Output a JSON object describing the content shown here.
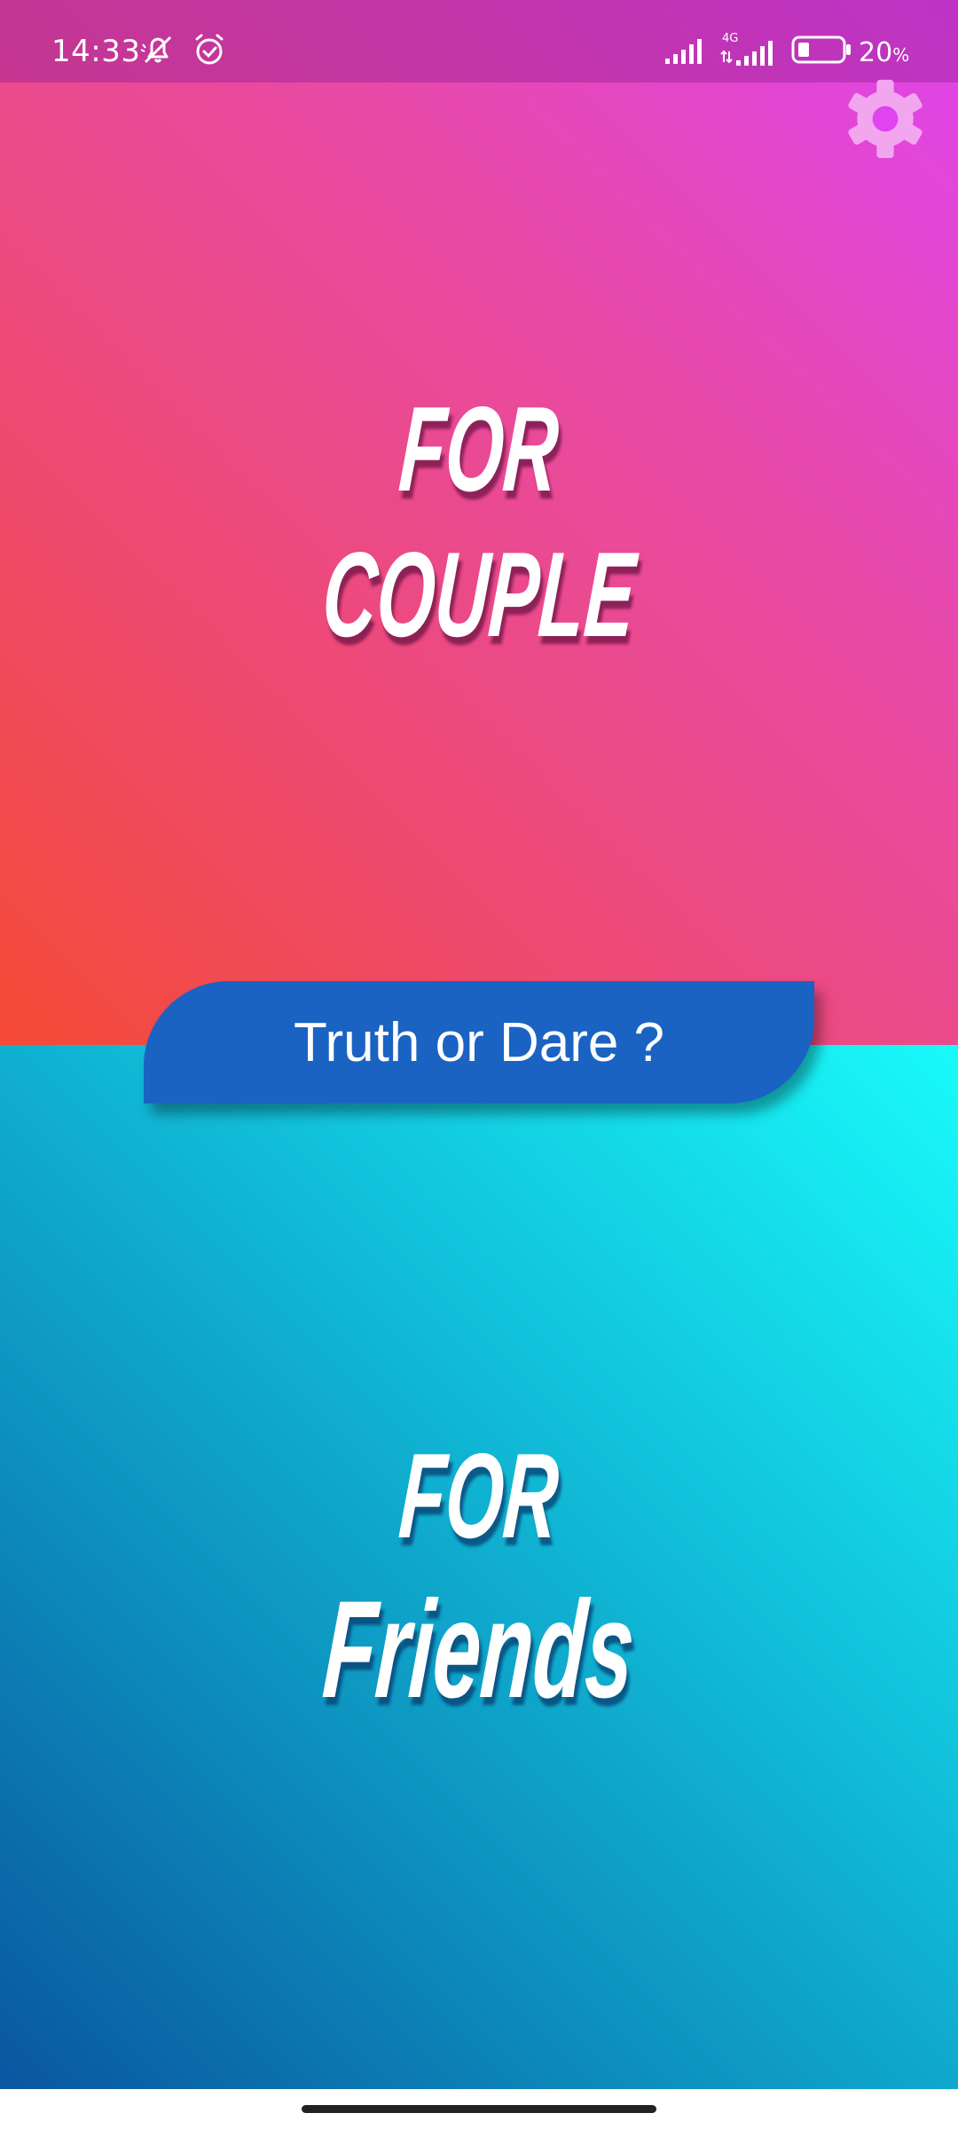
{
  "status_bar": {
    "time": "14:33",
    "battery_percent": "20",
    "battery_unit": "%",
    "network_label": "4G",
    "icons": [
      "muted-notification-icon",
      "alarm-icon",
      "signal-icon",
      "4g-signal-icon",
      "battery-icon"
    ]
  },
  "settings": {
    "icon": "gear-icon"
  },
  "couple_panel": {
    "line1": "FOR",
    "line2": "COUPLE",
    "colors": [
      "#f44a35",
      "#ee4a6f",
      "#e84aa6",
      "#df44ee"
    ]
  },
  "center_badge": {
    "label": "Truth or Dare ?",
    "color": "#1a63c2"
  },
  "friends_panel": {
    "line1": "FOR",
    "line2": "Friends",
    "colors": [
      "#0a56a0",
      "#0d93bf",
      "#12c4dd",
      "#18fafa"
    ]
  }
}
